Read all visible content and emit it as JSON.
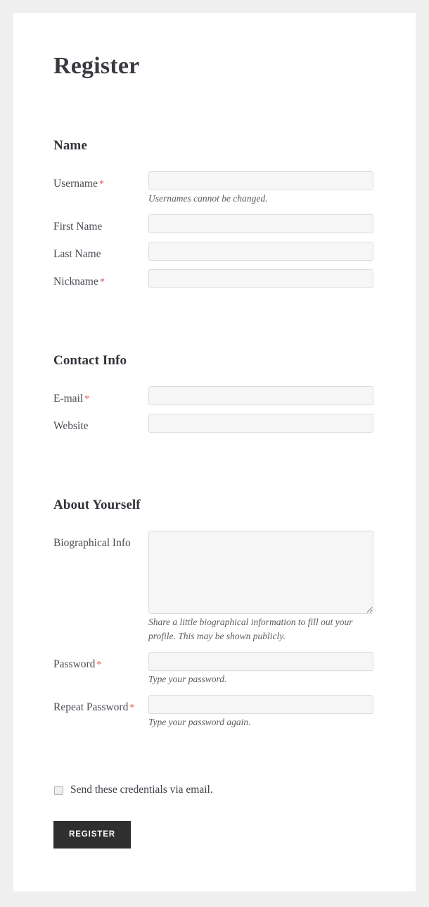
{
  "page": {
    "title": "Register"
  },
  "sections": [
    {
      "heading": "Name",
      "fields": [
        {
          "label": "Username",
          "required": true,
          "required_mark": "*",
          "type": "text",
          "value": "",
          "placeholder": "",
          "description": "Usernames cannot be changed."
        },
        {
          "label": "First Name",
          "required": false,
          "required_mark": "",
          "type": "text",
          "value": "",
          "placeholder": "",
          "description": ""
        },
        {
          "label": "Last Name",
          "required": false,
          "required_mark": "",
          "type": "text",
          "value": "",
          "placeholder": "",
          "description": ""
        },
        {
          "label": "Nickname",
          "required": true,
          "required_mark": "*",
          "type": "text",
          "value": "",
          "placeholder": "",
          "description": ""
        }
      ]
    },
    {
      "heading": "Contact Info",
      "fields": [
        {
          "label": "E-mail",
          "required": true,
          "required_mark": "*",
          "type": "email",
          "value": "",
          "placeholder": "",
          "description": ""
        },
        {
          "label": "Website",
          "required": false,
          "required_mark": "",
          "type": "url",
          "value": "",
          "placeholder": "",
          "description": ""
        }
      ]
    },
    {
      "heading": "About Yourself",
      "fields": [
        {
          "label": "Biographical Info",
          "required": false,
          "required_mark": "",
          "type": "textarea",
          "value": "",
          "placeholder": "",
          "description": "Share a little biographical information to fill out your profile. This may be shown publicly."
        },
        {
          "label": "Password",
          "required": true,
          "required_mark": "*",
          "type": "password",
          "value": "",
          "placeholder": "",
          "description": "Type your password."
        },
        {
          "label": "Repeat Password",
          "required": true,
          "required_mark": "*",
          "type": "password",
          "value": "",
          "placeholder": "",
          "description": "Type your password again."
        }
      ]
    }
  ],
  "options": {
    "send_credentials": {
      "label": "Send these credentials via email.",
      "checked": false
    }
  },
  "submit": {
    "label": "Register"
  },
  "colors": {
    "page_background": "#f0efef",
    "card_background": "#ffffff",
    "heading_text": "#33333b",
    "label_text": "#4b4b55",
    "required_asterisk": "#e2574c",
    "input_background": "#f6f6f6",
    "input_border": "#dcdcdc",
    "description_text": "#5b5b63",
    "button_background": "#2f2f2f",
    "button_text": "#ffffff"
  }
}
